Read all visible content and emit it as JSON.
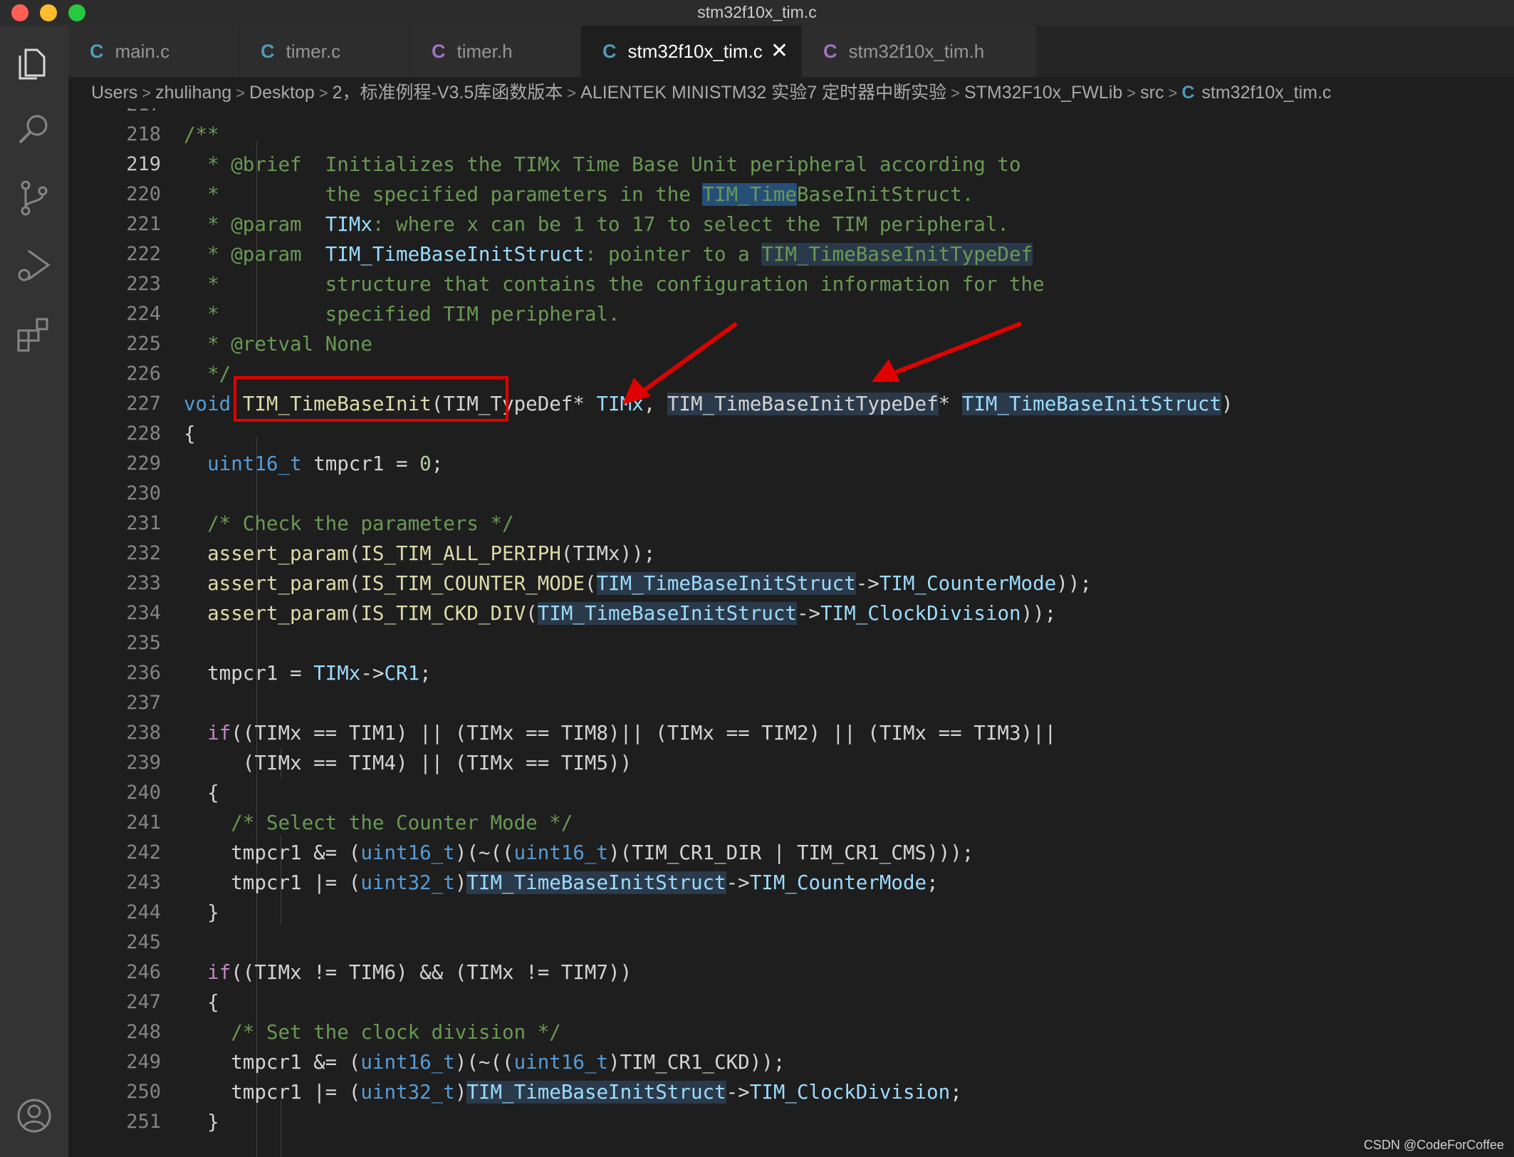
{
  "window": {
    "title": "stm32f10x_tim.c"
  },
  "tabs": [
    {
      "icon": "C",
      "label": "main.c"
    },
    {
      "icon": "C",
      "label": "timer.c"
    },
    {
      "icon": "C",
      "label": "timer.h"
    },
    {
      "icon": "C",
      "label": "stm32f10x_tim.c",
      "close": "✕"
    },
    {
      "icon": "C",
      "label": "stm32f10x_tim.h"
    }
  ],
  "breadcrumb": [
    "Users",
    "zhulihang",
    "Desktop",
    "2，标准例程-V3.5库函数版本",
    "ALIENTEK MINISTM32 实验7 定时器中断实验",
    "STM32F10x_FWLib",
    "src",
    "stm32f10x_tim.c"
  ],
  "breadcrumb_icon": "C",
  "line_numbers": [
    "217",
    "218",
    "219",
    "220",
    "221",
    "222",
    "223",
    "224",
    "225",
    "226",
    "227",
    "228",
    "229",
    "230",
    "231",
    "232",
    "233",
    "234",
    "235",
    "236",
    "237",
    "238",
    "239",
    "240",
    "241",
    "242",
    "243",
    "244",
    "245",
    "246",
    "247",
    "248",
    "249",
    "250",
    "251"
  ],
  "current_line": "219",
  "code": {
    "l217": "/**",
    "l218_a": "  * @brief",
    "l218_b": "  Initializes the TIMx Time Base Unit peripheral according to",
    "l219_a": "  *         the specified parameters in the ",
    "l219_b": "TIM_Time",
    "l219_c": "BaseInitStruct.",
    "l220_a": "  * @param",
    "l220_b": "  TIMx",
    "l220_c": ": where x can be 1 to 17 to select the TIM peripheral.",
    "l221_a": "  * @param",
    "l221_b": "  TIM_TimeBaseInitStruct",
    "l221_c": ": pointer to a ",
    "l221_d": "TIM_TimeBaseInitTypeDef",
    "l222": "  *         structure that contains the configuration information for the",
    "l223": "  *         specified TIM peripheral.",
    "l224_a": "  * @retval",
    "l224_b": " None",
    "l225": "  */",
    "l226_void": "void",
    "l226_fn": "TIM_TimeBaseInit",
    "l226_p1": "(TIM_TypeDef* ",
    "l226_timx": "TIMx",
    "l226_comma": ", ",
    "l226_type": "TIM_TimeBaseInitTypeDef",
    "l226_star": "* ",
    "l226_param": "TIM_TimeBaseInitStruct",
    "l226_end": ")",
    "l227": "{",
    "l228_type": "  uint16_t",
    "l228_rest": " tmpcr1 = ",
    "l228_num": "0",
    "l228_semi": ";",
    "l230": "  /* Check the parameters */",
    "l231_fn": "  assert_param",
    "l231_a": "(",
    "l231_mac": "IS_TIM_ALL_PERIPH",
    "l231_b": "(TIMx));",
    "l232_fn": "  assert_param",
    "l232_a": "(",
    "l232_mac": "IS_TIM_COUNTER_MODE",
    "l232_b": "(",
    "l232_p": "TIM_TimeBaseInitStruct",
    "l232_arrow": "->",
    "l232_m": "TIM_CounterMode",
    "l232_c": "));",
    "l233_fn": "  assert_param",
    "l233_a": "(",
    "l233_mac": "IS_TIM_CKD_DIV",
    "l233_b": "(",
    "l233_p": "TIM_TimeBaseInitStruct",
    "l233_arrow": "->",
    "l233_m": "TIM_ClockDivision",
    "l233_c": "));",
    "l235_a": "  tmpcr1 = ",
    "l235_p": "TIMx",
    "l235_arrow": "->",
    "l235_m": "CR1",
    "l235_semi": ";",
    "l237_if": "  if",
    "l237_rest": "((TIMx == TIM1) || (TIMx == TIM8)|| (TIMx == TIM2) || (TIMx == TIM3)||",
    "l238": "     (TIMx == TIM4) || (TIMx == TIM5))",
    "l239": "  {",
    "l240": "    /* Select the Counter Mode */",
    "l241_a": "    tmpcr1 &= (",
    "l241_t1": "uint16_t",
    "l241_b": ")(~((",
    "l241_t2": "uint16_t",
    "l241_c": ")(TIM_CR1_DIR | TIM_CR1_CMS)));",
    "l242_a": "    tmpcr1 |= (",
    "l242_t": "uint32_t",
    "l242_b": ")",
    "l242_p": "TIM_TimeBaseInitStruct",
    "l242_arrow": "->",
    "l242_m": "TIM_CounterMode",
    "l242_semi": ";",
    "l243": "  }",
    "l245_if": "  if",
    "l245_rest": "((TIMx != TIM6) && (TIMx != TIM7))",
    "l246": "  {",
    "l247": "    /* Set the clock division */",
    "l248_a": "    tmpcr1 &= (",
    "l248_t1": "uint16_t",
    "l248_b": ")(~((",
    "l248_t2": "uint16_t",
    "l248_c": ")TIM_CR1_CKD));",
    "l249_a": "    tmpcr1 |= (",
    "l249_t": "uint32_t",
    "l249_b": ")",
    "l249_p": "TIM_TimeBaseInitStruct",
    "l249_arrow": "->",
    "l249_m": "TIM_ClockDivision",
    "l249_semi": ";",
    "l250": "  }"
  },
  "watermark": "CSDN @CodeForCoffee",
  "colors": {
    "comment": "#6a9955",
    "keyword": "#569cd6",
    "type": "#4ec9b0",
    "function": "#dcdcaa",
    "param": "#9cdcfe",
    "annotation_red": "#e00000"
  },
  "icons": [
    "files-icon",
    "search-icon",
    "source-control-icon",
    "run-debug-icon",
    "extensions-icon",
    "account-icon"
  ]
}
